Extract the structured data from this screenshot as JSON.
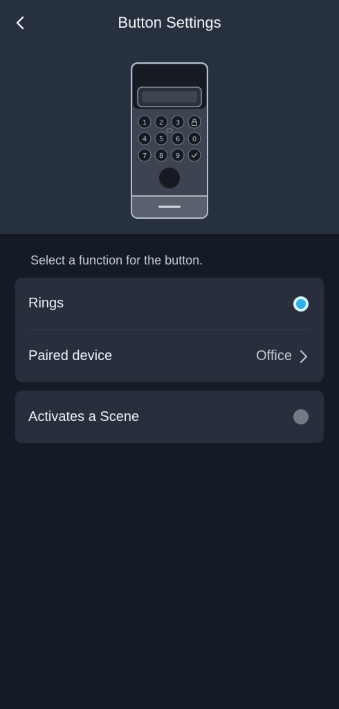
{
  "header": {
    "title": "Button Settings",
    "back_icon": "chevron-left-icon"
  },
  "device_image": {
    "keys": [
      "1",
      "2",
      "3",
      "lock",
      "4",
      "5",
      "6",
      "0",
      "7",
      "8",
      "9",
      "check"
    ]
  },
  "hint": "Select a function for the button.",
  "options": {
    "rings": {
      "label": "Rings",
      "selected": true
    },
    "paired_device": {
      "label": "Paired device",
      "value": "Office"
    },
    "scene": {
      "label": "Activates a Scene",
      "selected": false
    }
  },
  "colors": {
    "header_bg": "#27303f",
    "page_bg": "#151b26",
    "card_bg": "#272f3d",
    "accent": "#29b3ea"
  }
}
